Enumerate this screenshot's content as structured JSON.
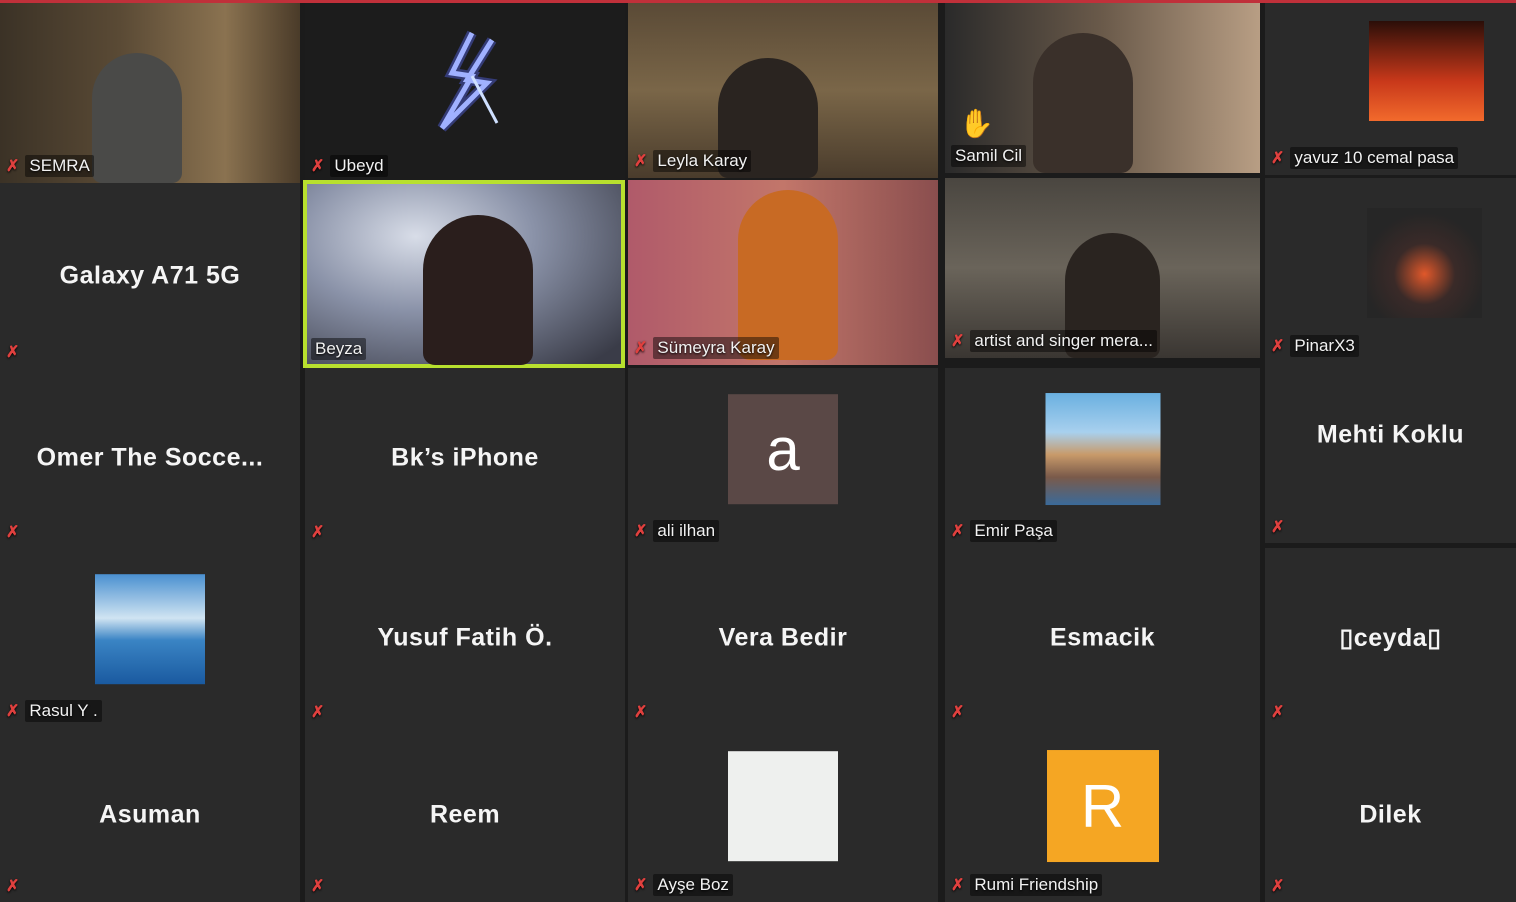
{
  "colors": {
    "mute": "#e0403e",
    "speaker_border": "#b8e02e",
    "top_bar": "#c0303a"
  },
  "tiles": [
    {
      "name": "SEMRA",
      "type": "video",
      "muted": true
    },
    {
      "name": "Ubeyd",
      "type": "video",
      "muted": true
    },
    {
      "name": "Leyla Karay",
      "type": "video",
      "muted": true
    },
    {
      "name": "Samil Cil",
      "type": "video",
      "muted": false,
      "raised_hand": true
    },
    {
      "name": "yavuz 10 cemal pasa",
      "type": "video",
      "muted": true
    },
    {
      "name": "Galaxy A71 5G",
      "type": "name",
      "muted": true
    },
    {
      "name": "Beyza",
      "type": "video",
      "muted": false,
      "active_speaker": true
    },
    {
      "name": "Sümeyra Karay",
      "type": "video",
      "muted": true
    },
    {
      "name": "artist and singer mera...",
      "type": "video",
      "muted": true
    },
    {
      "name": "PinarX3",
      "type": "video",
      "muted": true
    },
    {
      "name": "Omer  The  Socce...",
      "type": "name",
      "muted": true
    },
    {
      "name": "Bk’s iPhone",
      "type": "name",
      "muted": true
    },
    {
      "name": "ali ilhan",
      "type": "avatar",
      "avatar_letter": "a",
      "muted": true
    },
    {
      "name": "Emir Paşa",
      "type": "avatar",
      "muted": true
    },
    {
      "name": "Mehti Koklu",
      "type": "name",
      "muted": true
    },
    {
      "name": "Rasul Y .",
      "type": "avatar",
      "muted": true
    },
    {
      "name": "Yusuf Fatih Ö.",
      "type": "name",
      "muted": true
    },
    {
      "name": "Vera Bedir",
      "type": "name",
      "muted": true
    },
    {
      "name": "Esmacik",
      "type": "name",
      "muted": true
    },
    {
      "name": "▯ceyda▯",
      "type": "name",
      "muted": true
    },
    {
      "name": "Asuman",
      "type": "name",
      "muted": true
    },
    {
      "name": "Reem",
      "type": "name",
      "muted": true
    },
    {
      "name": "Ayşe Boz",
      "type": "avatar",
      "muted": true
    },
    {
      "name": "Rumi Friendship",
      "type": "avatar",
      "avatar_letter": "R",
      "muted": true
    },
    {
      "name": "Dilek",
      "type": "name",
      "muted": true
    }
  ]
}
